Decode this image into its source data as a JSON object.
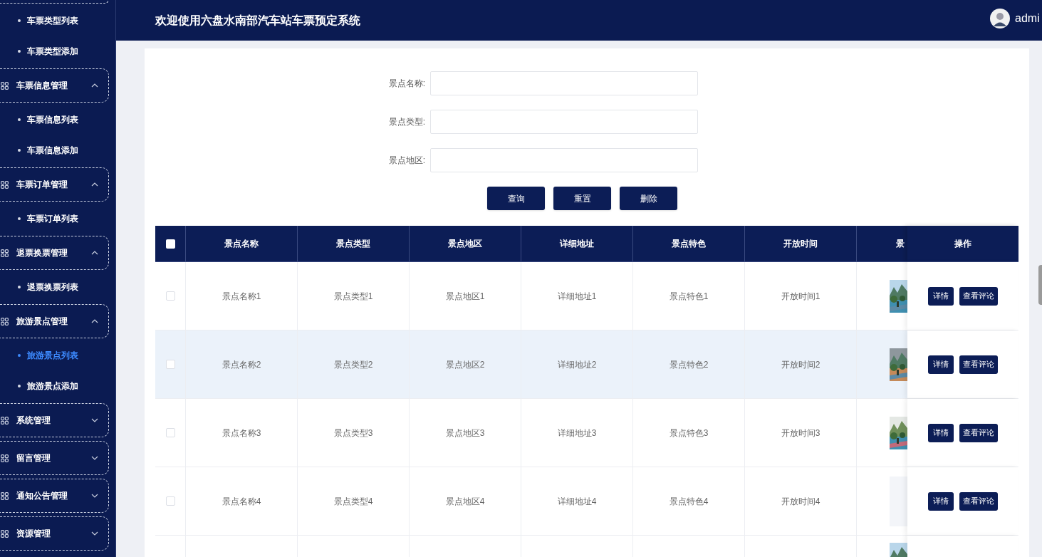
{
  "header": {
    "title": "欢迎使用六盘水南部汽车站车票预定系统",
    "user": "admi"
  },
  "sidebar": [
    {
      "kind": "group-edge"
    },
    {
      "kind": "item",
      "label": "车票类型列表",
      "selected": false
    },
    {
      "kind": "item",
      "label": "车票类型添加",
      "selected": false
    },
    {
      "kind": "group",
      "label": "车票信息管理",
      "expanded": true
    },
    {
      "kind": "item",
      "label": "车票信息列表",
      "selected": false
    },
    {
      "kind": "item",
      "label": "车票信息添加",
      "selected": false
    },
    {
      "kind": "group",
      "label": "车票订单管理",
      "expanded": true
    },
    {
      "kind": "item",
      "label": "车票订单列表",
      "selected": false
    },
    {
      "kind": "group",
      "label": "退票换票管理",
      "expanded": true
    },
    {
      "kind": "item",
      "label": "退票换票列表",
      "selected": false
    },
    {
      "kind": "group",
      "label": "旅游景点管理",
      "expanded": true
    },
    {
      "kind": "item",
      "label": "旅游景点列表",
      "selected": true
    },
    {
      "kind": "item",
      "label": "旅游景点添加",
      "selected": false
    },
    {
      "kind": "group",
      "label": "系统管理",
      "expanded": false
    },
    {
      "kind": "group",
      "label": "留言管理",
      "expanded": false
    },
    {
      "kind": "group",
      "label": "通知公告管理",
      "expanded": false
    },
    {
      "kind": "group",
      "label": "资源管理",
      "expanded": false
    }
  ],
  "search": {
    "fields": [
      {
        "label": "景点名称:"
      },
      {
        "label": "景点类型:"
      },
      {
        "label": "景点地区:"
      }
    ],
    "buttons": [
      "查询",
      "重置",
      "删除"
    ]
  },
  "table": {
    "select_all": {
      "checked": false
    },
    "columns": [
      "景点名称",
      "景点类型",
      "景点地区",
      "详细地址",
      "景点特色",
      "开放时间"
    ],
    "cut_column": "景",
    "action_column": "操作",
    "rows": [
      {
        "checked": false,
        "highlighted": false,
        "image": {
          "kind": "picture"
        },
        "cells": [
          "景点名称1",
          "景点类型1",
          "景点地区1",
          "详细地址1",
          "景点特色1",
          "开放时间1"
        ],
        "actions": [
          "详情",
          "查看评论"
        ]
      },
      {
        "checked": false,
        "highlighted": true,
        "image": {
          "kind": "picture"
        },
        "cells": [
          "景点名称2",
          "景点类型2",
          "景点地区2",
          "详细地址2",
          "景点特色2",
          "开放时间2"
        ],
        "actions": [
          "详情",
          "查看评论"
        ]
      },
      {
        "checked": false,
        "highlighted": false,
        "image": {
          "kind": "picture"
        },
        "cells": [
          "景点名称3",
          "景点类型3",
          "景点地区3",
          "详细地址3",
          "景点特色3",
          "开放时间3"
        ],
        "actions": [
          "详情",
          "查看评论"
        ]
      },
      {
        "checked": false,
        "highlighted": false,
        "image": {
          "kind": "empty"
        },
        "cells": [
          "景点名称4",
          "景点类型4",
          "景点地区4",
          "详细地址4",
          "景点特色4",
          "开放时间4"
        ],
        "actions": [
          "详情",
          "查看评论"
        ]
      },
      {
        "image": {
          "kind": "picture"
        }
      }
    ]
  }
}
